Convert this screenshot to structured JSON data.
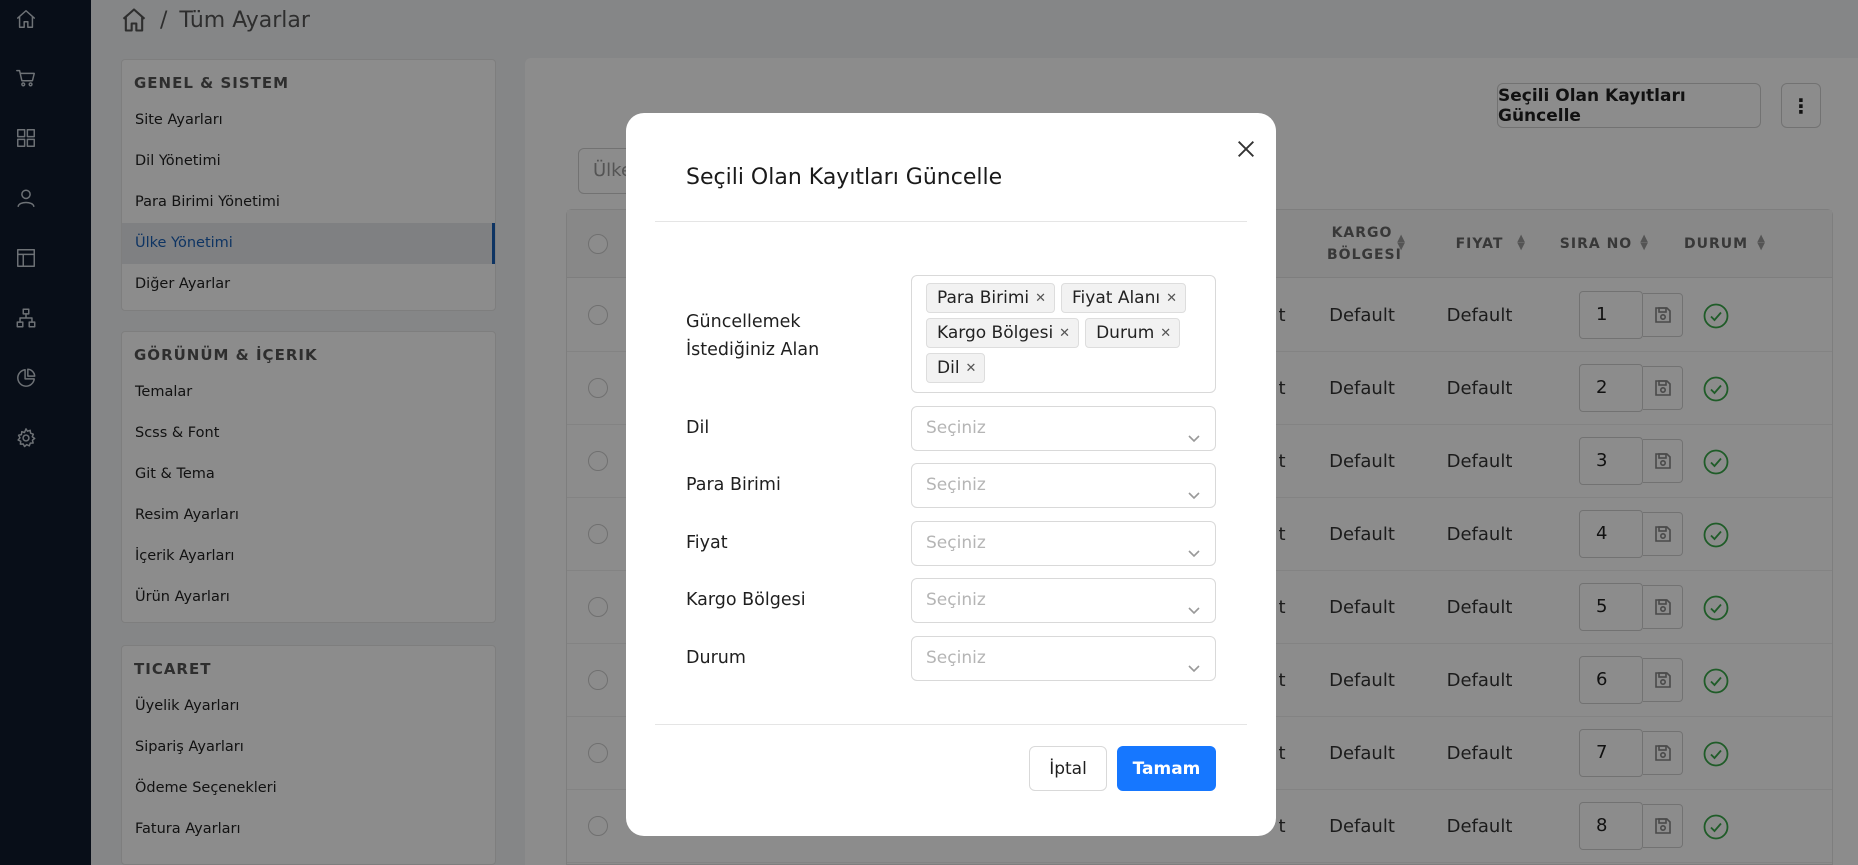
{
  "breadcrumb": {
    "separator": "/",
    "title": "Tüm Ayarlar"
  },
  "sidebar_rail": {
    "icons": [
      "home-icon",
      "cart-icon",
      "dashboard-icon",
      "user-icon",
      "layout-icon",
      "sitemap-icon",
      "pie-chart-icon",
      "gear-icon"
    ]
  },
  "settings_menu": {
    "groups": [
      {
        "title": "GENEL & SISTEM",
        "items": [
          "Site Ayarları",
          "Dil Yönetimi",
          "Para Birimi Yönetimi",
          "Ülke Yönetimi",
          "Diğer Ayarlar"
        ],
        "active": "Ülke Yönetimi"
      },
      {
        "title": "GÖRÜNÜM & İÇERIK",
        "items": [
          "Temalar",
          "Scss & Font",
          "Git & Tema",
          "Resim Ayarları",
          "İçerik Ayarları",
          "Ürün Ayarları"
        ]
      },
      {
        "title": "TICARET",
        "items": [
          "Üyelik Ayarları",
          "Sipariş Ayarları",
          "Ödeme Seçenekleri",
          "Fatura Ayarları"
        ]
      }
    ]
  },
  "toolbar": {
    "update_selected": "Seçili Olan Kayıtları Güncelle",
    "more": "⋮",
    "filter_placeholder": "Ülke"
  },
  "table": {
    "columns": [
      "KARGO BÖLGESI",
      "FIYAT",
      "SIRA NO",
      "DURUM"
    ],
    "rows": [
      {
        "partial": "t",
        "kargo": "Default",
        "fiyat": "Default",
        "sira": "1"
      },
      {
        "partial": "t",
        "kargo": "Default",
        "fiyat": "Default",
        "sira": "2"
      },
      {
        "partial": "t",
        "kargo": "Default",
        "fiyat": "Default",
        "sira": "3"
      },
      {
        "partial": "t",
        "kargo": "Default",
        "fiyat": "Default",
        "sira": "4"
      },
      {
        "partial": "t",
        "kargo": "Default",
        "fiyat": "Default",
        "sira": "5"
      },
      {
        "partial": "t",
        "kargo": "Default",
        "fiyat": "Default",
        "sira": "6"
      },
      {
        "partial": "t",
        "kargo": "Default",
        "fiyat": "Default",
        "sira": "7"
      },
      {
        "partial": "t",
        "kargo": "Default",
        "fiyat": "Default",
        "sira": "8"
      }
    ]
  },
  "modal": {
    "title": "Seçili Olan Kayıtları Güncelle",
    "fields_label": "Güncellemek İstediğiniz Alan",
    "selected_fields": [
      "Para Birimi",
      "Fiyat Alanı",
      "Kargo Bölgesi",
      "Durum",
      "Dil"
    ],
    "selects": [
      {
        "label": "Dil",
        "placeholder": "Seçiniz"
      },
      {
        "label": "Para Birimi",
        "placeholder": "Seçiniz"
      },
      {
        "label": "Fiyat",
        "placeholder": "Seçiniz"
      },
      {
        "label": "Kargo Bölgesi",
        "placeholder": "Seçiniz"
      },
      {
        "label": "Durum",
        "placeholder": "Seçiniz"
      }
    ],
    "cancel_label": "İptal",
    "ok_label": "Tamam"
  },
  "colors": {
    "primary": "#1677ff",
    "rail_bg": "#0f1b2d",
    "active_link": "#1a5fb4",
    "status_ok": "#3aa84a"
  }
}
